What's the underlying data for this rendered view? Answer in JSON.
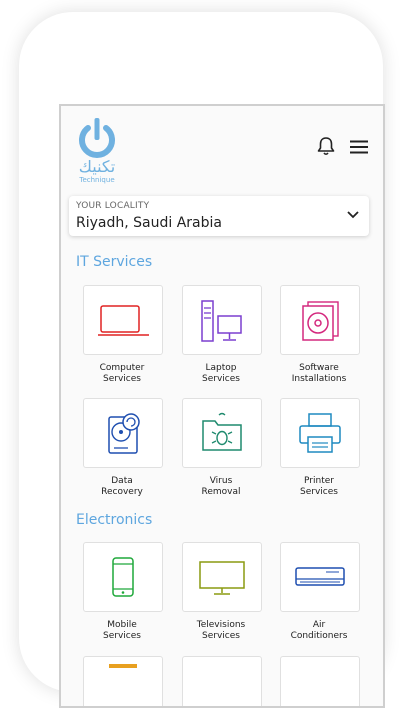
{
  "brand": {
    "arabic": "تكنيك",
    "name": "Technique"
  },
  "locality": {
    "label": "YOUR LOCALITY",
    "value": "Riyadh, Saudi Arabia"
  },
  "sections": [
    {
      "title": "IT Services",
      "items": [
        {
          "line1": "Computer",
          "line2": "Services",
          "icon": "laptop-icon",
          "color": "#e02222"
        },
        {
          "line1": "Laptop",
          "line2": "Services",
          "icon": "desktop-computer-icon",
          "color": "#7b3fcf"
        },
        {
          "line1": "Software",
          "line2": "Installations",
          "icon": "software-disc-icon",
          "color": "#d4287e"
        },
        {
          "line1": "Data",
          "line2": "Recovery",
          "icon": "hard-drive-icon",
          "color": "#1f4fb0"
        },
        {
          "line1": "Virus",
          "line2": "Removal",
          "icon": "virus-folder-icon",
          "color": "#1f8a6e"
        },
        {
          "line1": "Printer",
          "line2": "Services",
          "icon": "printer-icon",
          "color": "#1f8ac0"
        }
      ]
    },
    {
      "title": "Electronics",
      "items": [
        {
          "line1": "Mobile",
          "line2": "Services",
          "icon": "mobile-phone-icon",
          "color": "#1fa83a"
        },
        {
          "line1": "Televisions",
          "line2": "Services",
          "icon": "television-icon",
          "color": "#8a9a10"
        },
        {
          "line1": "Air",
          "line2": "Conditioners",
          "icon": "air-conditioner-icon",
          "color": "#1f4fb0"
        }
      ]
    }
  ]
}
